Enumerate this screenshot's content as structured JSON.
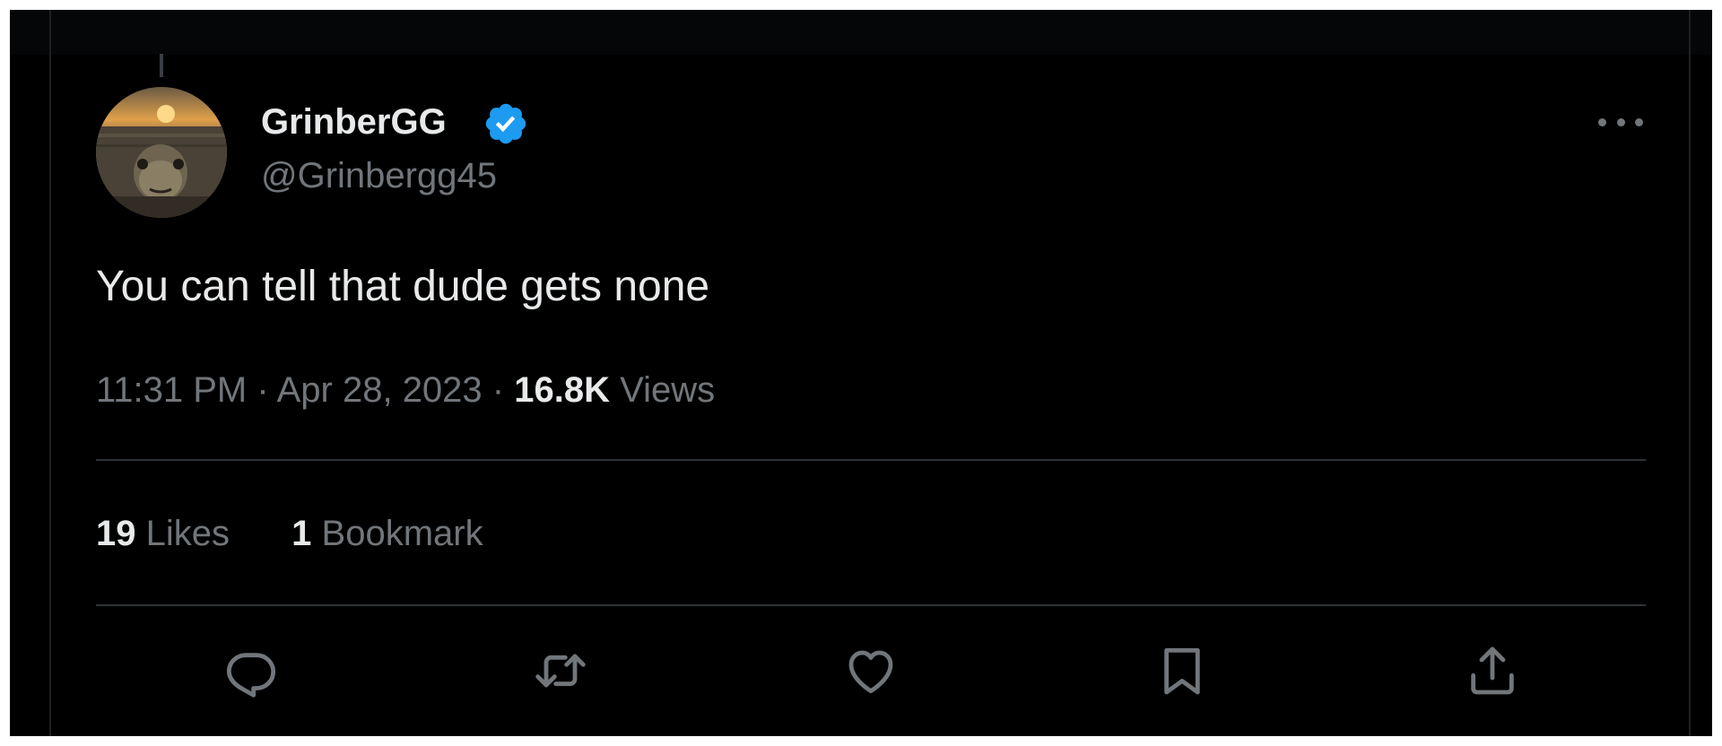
{
  "tweet": {
    "display_name": "GrinberGG",
    "handle": "@Grinbergg45",
    "text": "You can tell that dude gets none",
    "time": "11:31 PM",
    "date": "Apr 28, 2023",
    "views_count": "16.8K",
    "views_label": "Views",
    "separator": "·"
  },
  "stats": {
    "likes_count": "19",
    "likes_label": "Likes",
    "bookmarks_count": "1",
    "bookmarks_label": "Bookmark"
  },
  "icons": {
    "verified": "verified-badge-icon",
    "more": "more-icon",
    "reply": "reply-icon",
    "retweet": "retweet-icon",
    "like": "like-icon",
    "bookmark": "bookmark-icon",
    "share": "share-icon"
  },
  "colors": {
    "background": "#000000",
    "primary_text": "#e7e9ea",
    "secondary_text": "#71767b",
    "verified_blue": "#1d9bf0",
    "divider": "#2f3336"
  }
}
